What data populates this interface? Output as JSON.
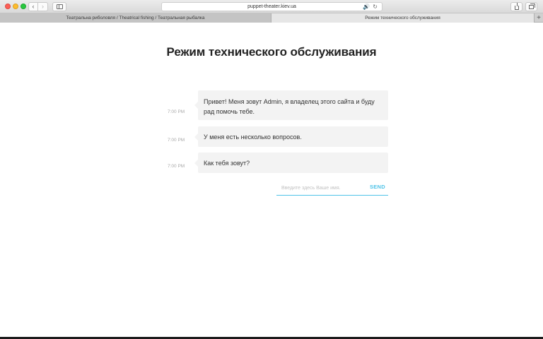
{
  "browser": {
    "url": "puppet-theater.kiev.ua",
    "tabs": [
      {
        "label": "Театральна риболовля / Theatrical fishing / Театральная рыбалка"
      },
      {
        "label": "Режим технического обслуживания"
      }
    ],
    "icons": {
      "back": "chevron-left-icon",
      "forward": "chevron-right-icon",
      "sidebar": "sidebar-icon",
      "speaker": "speaker-icon",
      "reload": "reload-icon",
      "share": "share-icon",
      "tabs_overview": "tabs-icon",
      "new_tab": "plus-icon"
    },
    "glyphs": {
      "back": "‹",
      "forward": "›",
      "speaker": "🔊",
      "reload": "↻",
      "new_tab": "+"
    }
  },
  "page": {
    "title": "Режим технического обслуживания",
    "messages": [
      {
        "time": "7:00 PM",
        "text": "Привет! Меня зовут Admin, я владелец этого сайта и буду рад помочь тебе."
      },
      {
        "time": "7:00 PM",
        "text": "У меня есть несколько вопросов."
      },
      {
        "time": "7:00 PM",
        "text": "Как тебя зовут?"
      }
    ],
    "input": {
      "value": "",
      "placeholder": "Введите здесь Ваше имя.",
      "send_label": "SEND"
    }
  },
  "colors": {
    "accent": "#4fc3e8",
    "bubble_bg": "#f3f3f3",
    "title": "#222222",
    "time": "#aaaaaa"
  }
}
